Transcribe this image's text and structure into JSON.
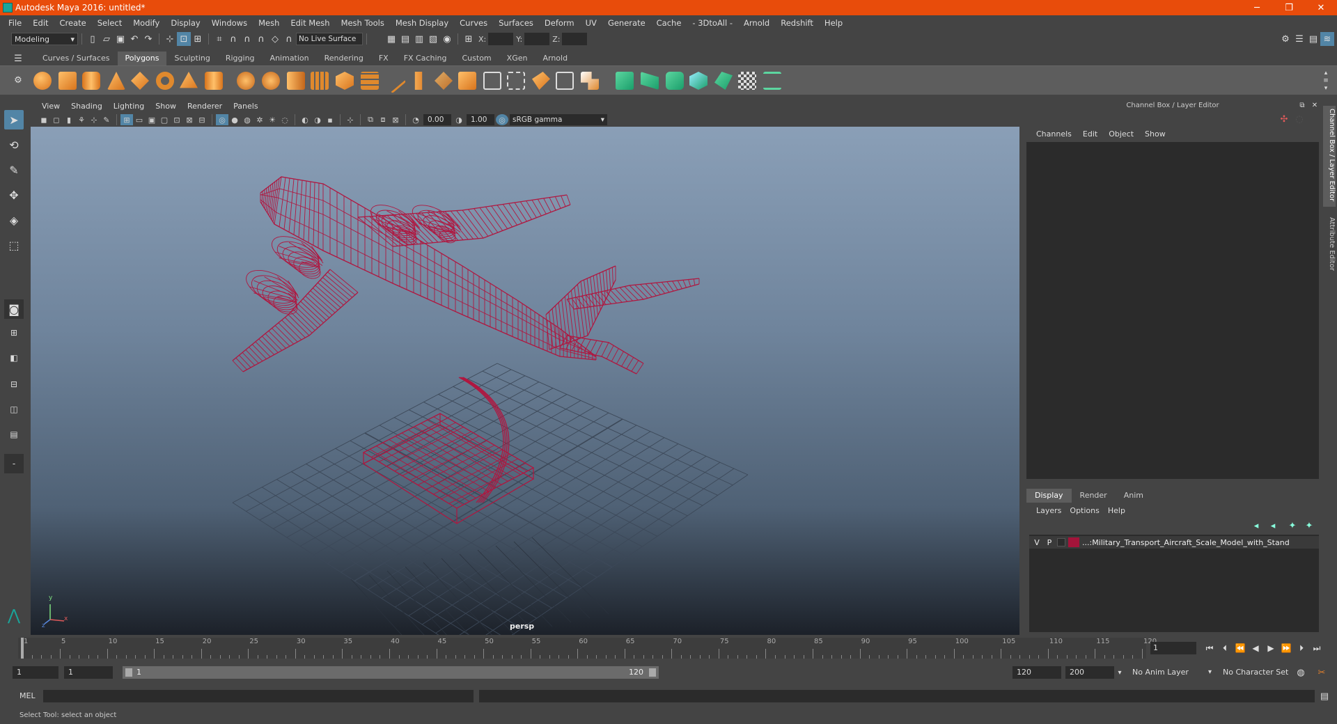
{
  "window": {
    "title": "Autodesk Maya 2016: untitled*",
    "minimize": "─",
    "maximize": "❐",
    "close": "✕"
  },
  "menubar": [
    "File",
    "Edit",
    "Create",
    "Select",
    "Modify",
    "Display",
    "Windows",
    "Mesh",
    "Edit Mesh",
    "Mesh Tools",
    "Mesh Display",
    "Curves",
    "Surfaces",
    "Deform",
    "UV",
    "Generate",
    "Cache",
    "- 3DtoAll -",
    "Arnold",
    "Redshift",
    "Help"
  ],
  "statusline": {
    "mode": "Modeling",
    "live_surface": "No Live Surface",
    "x_label": "X:",
    "y_label": "Y:",
    "z_label": "Z:"
  },
  "shelf": {
    "tabs": [
      "Curves / Surfaces",
      "Polygons",
      "Sculpting",
      "Rigging",
      "Animation",
      "Rendering",
      "FX",
      "FX Caching",
      "Custom",
      "XGen",
      "Arnold"
    ],
    "active_tab": "Polygons"
  },
  "viewport": {
    "menu": [
      "View",
      "Shading",
      "Lighting",
      "Show",
      "Renderer",
      "Panels"
    ],
    "exposure": "0.00",
    "gamma": "1.00",
    "color_space": "sRGB gamma",
    "camera": "persp",
    "axis_y": "y",
    "axis_x": "x",
    "axis_z": "z",
    "wire_color": "#b0163f"
  },
  "channel_box": {
    "header": "Channel Box / Layer Editor",
    "menu": [
      "Channels",
      "Edit",
      "Object",
      "Show"
    ],
    "side_tabs": [
      "Channel Box / Layer Editor",
      "Attribute Editor"
    ]
  },
  "layer_editor": {
    "tabs": [
      "Display",
      "Render",
      "Anim"
    ],
    "active_tab": "Display",
    "menu": [
      "Layers",
      "Options",
      "Help"
    ],
    "layers": [
      {
        "v": "V",
        "p": "P",
        "color": "#a3143a",
        "name": "...:Military_Transport_Aircraft_Scale_Model_with_Stand"
      }
    ]
  },
  "timeline": {
    "labels": [
      "1",
      "5",
      "10",
      "15",
      "20",
      "25",
      "30",
      "35",
      "40",
      "45",
      "50",
      "55",
      "60",
      "65",
      "70",
      "75",
      "80",
      "85",
      "90",
      "95",
      "100",
      "105",
      "110",
      "115",
      "120"
    ],
    "current_frame": "1"
  },
  "range": {
    "start": "1",
    "playback_start": "1",
    "slider_start": "1",
    "slider_end": "120",
    "playback_end": "120",
    "end": "200",
    "anim_layer": "No Anim Layer",
    "character_set": "No Character Set"
  },
  "command": {
    "label": "MEL"
  },
  "help": {
    "text": "Select Tool: select an object"
  }
}
